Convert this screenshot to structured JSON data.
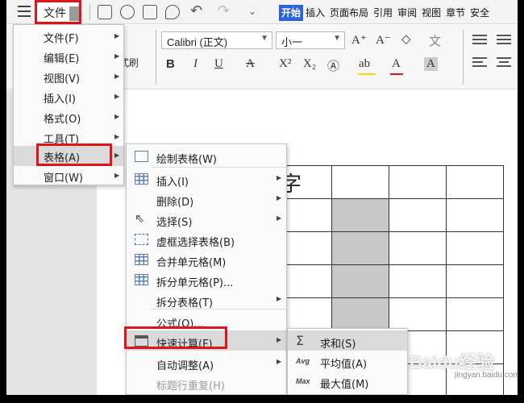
{
  "titlebar": {
    "file_button": "文件",
    "tabs": [
      "开始",
      "插入",
      "页面布局",
      "引用",
      "审阅",
      "视图",
      "章节",
      "安全"
    ],
    "active_tab": "开始"
  },
  "ribbon": {
    "format_painter": "式刷",
    "font_name": "Calibri (正文)",
    "font_size": "小一",
    "bold": "B",
    "italic": "I",
    "underline": "U",
    "strike": "A",
    "superscript": "X²",
    "subscript": "X₂",
    "font_color": "A",
    "char_border": "A",
    "highlight_color": "#f5d800",
    "font_color_value": "#e0141c"
  },
  "doc": {
    "visible_char": "字"
  },
  "menu_main": {
    "items": [
      {
        "label": "文件(F)"
      },
      {
        "label": "编辑(E)"
      },
      {
        "label": "视图(V)"
      },
      {
        "label": "插入(I)"
      },
      {
        "label": "格式(O)"
      },
      {
        "label": "工具(T)"
      },
      {
        "label": "表格(A)"
      },
      {
        "label": "窗口(W)"
      }
    ]
  },
  "menu_table": {
    "items": [
      {
        "label": "绘制表格(W)"
      },
      {
        "label": "插入(I)"
      },
      {
        "label": "删除(D)"
      },
      {
        "label": "选择(S)"
      },
      {
        "label": "虚框选择表格(B)"
      },
      {
        "label": "合并单元格(M)"
      },
      {
        "label": "拆分单元格(P)..."
      },
      {
        "label": "拆分表格(T)"
      },
      {
        "label": "公式(O)..."
      },
      {
        "label": "快速计算(F)"
      },
      {
        "label": "自动调整(A)"
      },
      {
        "label": "标题行重复(H)"
      }
    ]
  },
  "menu_quickcalc": {
    "items": [
      {
        "label": "求和(S)",
        "icon": "Σ"
      },
      {
        "label": "平均值(A)",
        "icon": "Avg"
      },
      {
        "label": "最大值(M)",
        "icon": "Max"
      }
    ]
  },
  "watermark": {
    "text": "Baidu经验",
    "sub": "jingyan.baidu.com"
  },
  "colors": {
    "highlight_border": "#e0141c",
    "active_tab": "#2c63d8"
  }
}
